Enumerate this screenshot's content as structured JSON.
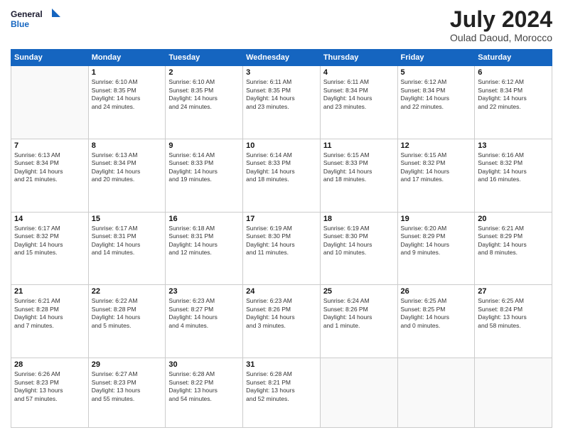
{
  "logo": {
    "line1": "General",
    "line2": "Blue"
  },
  "title": "July 2024",
  "subtitle": "Oulad Daoud, Morocco",
  "days_of_week": [
    "Sunday",
    "Monday",
    "Tuesday",
    "Wednesday",
    "Thursday",
    "Friday",
    "Saturday"
  ],
  "weeks": [
    [
      {
        "day": "",
        "content": ""
      },
      {
        "day": "1",
        "content": "Sunrise: 6:10 AM\nSunset: 8:35 PM\nDaylight: 14 hours\nand 24 minutes."
      },
      {
        "day": "2",
        "content": "Sunrise: 6:10 AM\nSunset: 8:35 PM\nDaylight: 14 hours\nand 24 minutes."
      },
      {
        "day": "3",
        "content": "Sunrise: 6:11 AM\nSunset: 8:35 PM\nDaylight: 14 hours\nand 23 minutes."
      },
      {
        "day": "4",
        "content": "Sunrise: 6:11 AM\nSunset: 8:34 PM\nDaylight: 14 hours\nand 23 minutes."
      },
      {
        "day": "5",
        "content": "Sunrise: 6:12 AM\nSunset: 8:34 PM\nDaylight: 14 hours\nand 22 minutes."
      },
      {
        "day": "6",
        "content": "Sunrise: 6:12 AM\nSunset: 8:34 PM\nDaylight: 14 hours\nand 22 minutes."
      }
    ],
    [
      {
        "day": "7",
        "content": "Sunrise: 6:13 AM\nSunset: 8:34 PM\nDaylight: 14 hours\nand 21 minutes."
      },
      {
        "day": "8",
        "content": "Sunrise: 6:13 AM\nSunset: 8:34 PM\nDaylight: 14 hours\nand 20 minutes."
      },
      {
        "day": "9",
        "content": "Sunrise: 6:14 AM\nSunset: 8:33 PM\nDaylight: 14 hours\nand 19 minutes."
      },
      {
        "day": "10",
        "content": "Sunrise: 6:14 AM\nSunset: 8:33 PM\nDaylight: 14 hours\nand 18 minutes."
      },
      {
        "day": "11",
        "content": "Sunrise: 6:15 AM\nSunset: 8:33 PM\nDaylight: 14 hours\nand 18 minutes."
      },
      {
        "day": "12",
        "content": "Sunrise: 6:15 AM\nSunset: 8:32 PM\nDaylight: 14 hours\nand 17 minutes."
      },
      {
        "day": "13",
        "content": "Sunrise: 6:16 AM\nSunset: 8:32 PM\nDaylight: 14 hours\nand 16 minutes."
      }
    ],
    [
      {
        "day": "14",
        "content": "Sunrise: 6:17 AM\nSunset: 8:32 PM\nDaylight: 14 hours\nand 15 minutes."
      },
      {
        "day": "15",
        "content": "Sunrise: 6:17 AM\nSunset: 8:31 PM\nDaylight: 14 hours\nand 14 minutes."
      },
      {
        "day": "16",
        "content": "Sunrise: 6:18 AM\nSunset: 8:31 PM\nDaylight: 14 hours\nand 12 minutes."
      },
      {
        "day": "17",
        "content": "Sunrise: 6:19 AM\nSunset: 8:30 PM\nDaylight: 14 hours\nand 11 minutes."
      },
      {
        "day": "18",
        "content": "Sunrise: 6:19 AM\nSunset: 8:30 PM\nDaylight: 14 hours\nand 10 minutes."
      },
      {
        "day": "19",
        "content": "Sunrise: 6:20 AM\nSunset: 8:29 PM\nDaylight: 14 hours\nand 9 minutes."
      },
      {
        "day": "20",
        "content": "Sunrise: 6:21 AM\nSunset: 8:29 PM\nDaylight: 14 hours\nand 8 minutes."
      }
    ],
    [
      {
        "day": "21",
        "content": "Sunrise: 6:21 AM\nSunset: 8:28 PM\nDaylight: 14 hours\nand 7 minutes."
      },
      {
        "day": "22",
        "content": "Sunrise: 6:22 AM\nSunset: 8:28 PM\nDaylight: 14 hours\nand 5 minutes."
      },
      {
        "day": "23",
        "content": "Sunrise: 6:23 AM\nSunset: 8:27 PM\nDaylight: 14 hours\nand 4 minutes."
      },
      {
        "day": "24",
        "content": "Sunrise: 6:23 AM\nSunset: 8:26 PM\nDaylight: 14 hours\nand 3 minutes."
      },
      {
        "day": "25",
        "content": "Sunrise: 6:24 AM\nSunset: 8:26 PM\nDaylight: 14 hours\nand 1 minute."
      },
      {
        "day": "26",
        "content": "Sunrise: 6:25 AM\nSunset: 8:25 PM\nDaylight: 14 hours\nand 0 minutes."
      },
      {
        "day": "27",
        "content": "Sunrise: 6:25 AM\nSunset: 8:24 PM\nDaylight: 13 hours\nand 58 minutes."
      }
    ],
    [
      {
        "day": "28",
        "content": "Sunrise: 6:26 AM\nSunset: 8:23 PM\nDaylight: 13 hours\nand 57 minutes."
      },
      {
        "day": "29",
        "content": "Sunrise: 6:27 AM\nSunset: 8:23 PM\nDaylight: 13 hours\nand 55 minutes."
      },
      {
        "day": "30",
        "content": "Sunrise: 6:28 AM\nSunset: 8:22 PM\nDaylight: 13 hours\nand 54 minutes."
      },
      {
        "day": "31",
        "content": "Sunrise: 6:28 AM\nSunset: 8:21 PM\nDaylight: 13 hours\nand 52 minutes."
      },
      {
        "day": "",
        "content": ""
      },
      {
        "day": "",
        "content": ""
      },
      {
        "day": "",
        "content": ""
      }
    ]
  ]
}
